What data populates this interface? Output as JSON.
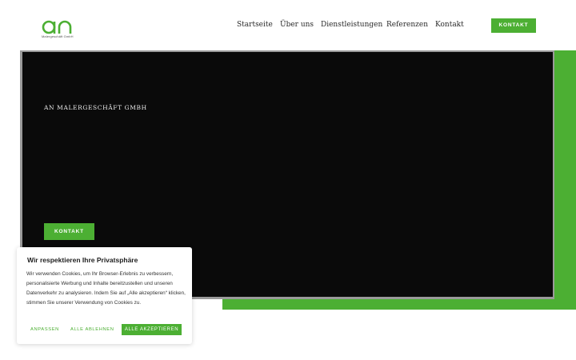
{
  "brand": {
    "logo_text": "an",
    "logo_subtitle": "Malergeschäft GmbH",
    "accent_color": "#4caf33"
  },
  "nav": {
    "items": [
      {
        "label": "Startseite"
      },
      {
        "label": "Über uns"
      },
      {
        "label": "Dienstleistungen"
      },
      {
        "label": "Referenzen"
      },
      {
        "label": "Kontakt"
      }
    ],
    "cta_label": "KONTAKT"
  },
  "hero": {
    "title": "AN MALERGESCHÄFT GMBH",
    "cta_label": "KONTAKT"
  },
  "cookie": {
    "title": "Wir respektieren Ihre Privatsphäre",
    "text": "Wir verwenden Cookies, um Ihr Browser-Erlebnis zu verbessern, personalisierte Werbung und Inhalte bereitzustellen und unseren Datenverkehr zu analysieren. Indem Sie auf „Alle akzeptieren“ klicken, stimmen Sie unserer Verwendung von Cookies zu.",
    "customize_label": "ANPASSEN",
    "reject_label": "ALLE ABLEHNEN",
    "accept_label": "ALLE AKZEPTIEREN"
  }
}
